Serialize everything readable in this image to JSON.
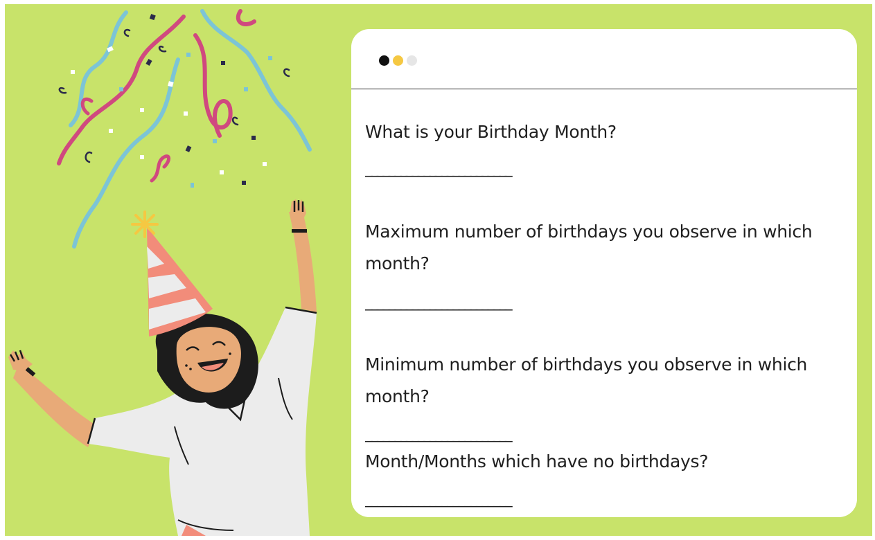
{
  "card": {
    "window_dots": [
      {
        "name": "black-dot",
        "color": "#111111"
      },
      {
        "name": "yellow-dot",
        "color": "#f5c842"
      },
      {
        "name": "grey-dot",
        "color": "#e6e6e6"
      }
    ],
    "questions": [
      {
        "text": "What is your Birthday Month?",
        "blank": "_________________________"
      },
      {
        "text": "Maximum number of birthdays you observe in which month?",
        "blank": "_________________________"
      },
      {
        "text": "Minimum number of birthdays you observe in which month?",
        "blank": "_________________________"
      },
      {
        "text": "Month/Months which have no birthdays?",
        "blank": "_________________________"
      }
    ]
  },
  "colors": {
    "background": "#c8e36a",
    "card": "#ffffff",
    "hat_stripe": "#f28c7a",
    "confetti_pink": "#d0497f",
    "confetti_blue": "#7cc4d6",
    "skin": "#e8aa78",
    "hair": "#1c1c1c",
    "shirt": "#ececec"
  },
  "icons": [
    "party-hat-icon",
    "confetti-icon",
    "celebrating-person-illustration"
  ]
}
